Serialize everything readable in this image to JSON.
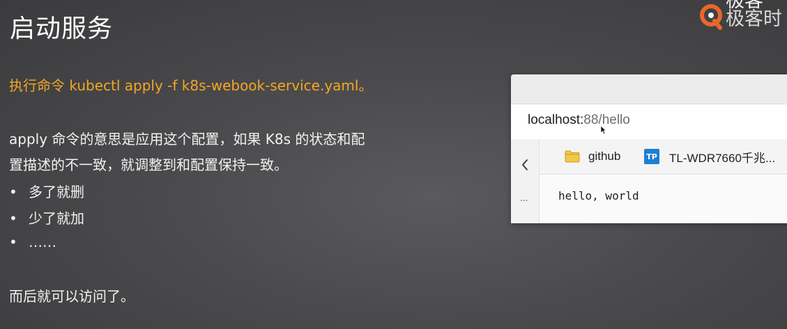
{
  "slide": {
    "title": "启动服务",
    "command_line": "执行命令 kubectl apply -f k8s-webook-service.yaml。",
    "paragraph_line1": "apply 命令的意思是应用这个配置，如果 K8s 的状态和配",
    "paragraph_line2": "置描述的不一致，就调整到和配置保持一致。",
    "bullets": [
      {
        "marker": "•",
        "text": "多了就删"
      },
      {
        "marker": "•",
        "text": "少了就加"
      },
      {
        "marker": "•",
        "text": "……"
      }
    ],
    "closing": "而后就可以访问了。"
  },
  "logo": {
    "text_top": "极客",
    "text_bottom": "极客时",
    "accent_color": "#e8672a"
  },
  "browser": {
    "address_host": "localhost:",
    "address_path": "88/hello",
    "bookmarks": [
      {
        "label": "github",
        "icon": "folder-icon"
      },
      {
        "label": "TL-WDR7660千兆...",
        "icon": "tp-icon",
        "icon_text": "TP"
      }
    ],
    "back_icon": "chevron-left-icon",
    "more_label": "...",
    "page_text": "hello, world"
  },
  "colors": {
    "command": "#f5a623",
    "text": "#f2f2f2",
    "tp_blue": "#1e7fd0",
    "folder_yellow": "#f2c84b"
  }
}
